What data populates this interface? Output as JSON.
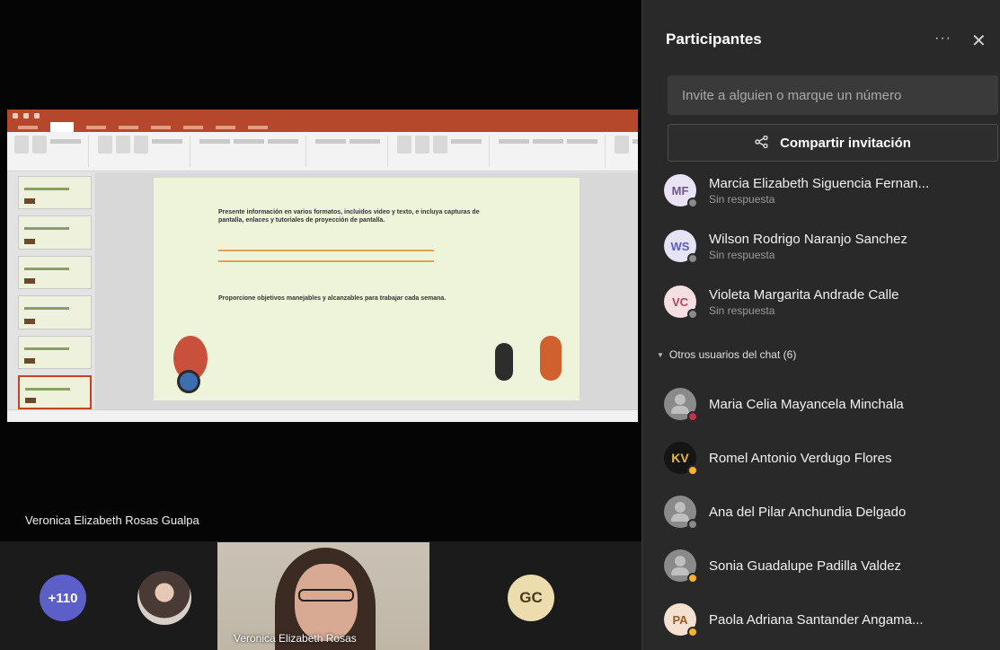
{
  "presenter": {
    "name": "Veronica Elizabeth Rosas Gualpa"
  },
  "slide": {
    "bullet1": "Presente información en varios formatos, incluidos video y texto, e incluya capturas de pantalla, enlaces y tutoriales de proyección de pantalla.",
    "bullet2": "Proporcione objetivos manejables y alcanzables para trabajar cada semana."
  },
  "strip": {
    "more_count": "+110",
    "video_name": "Veronica Elizabeth Rosas",
    "gc_initials": "GC"
  },
  "panel": {
    "title": "Participantes",
    "more_options": "···",
    "close": "✕",
    "invite_placeholder": "Invite a alguien o marque un número",
    "share_label": "Compartir invitación",
    "section_label": "Otros usuarios del chat (6)",
    "participants": [
      {
        "initials": "MF",
        "name": "Marcia Elizabeth Siguencia Fernan...",
        "status": "Sin respuesta"
      },
      {
        "initials": "WS",
        "name": "Wilson Rodrigo Naranjo Sanchez",
        "status": "Sin respuesta"
      },
      {
        "initials": "VC",
        "name": "Violeta Margarita Andrade Calle",
        "status": "Sin respuesta"
      }
    ],
    "chat_users": [
      {
        "initials": "",
        "name": "Maria Celia Mayancela Minchala"
      },
      {
        "initials": "KV",
        "name": "Romel Antonio Verdugo Flores"
      },
      {
        "initials": "",
        "name": "Ana del Pilar Anchundia Delgado"
      },
      {
        "initials": "",
        "name": "Sonia Guadalupe Padilla Valdez"
      },
      {
        "initials": "PA",
        "name": "Paola Adriana Santander Angama..."
      }
    ]
  },
  "colors": {
    "accent": "#5b5fc7",
    "panel_bg": "#292929",
    "ppt_red": "#b7472a",
    "status_away": "#f8b32b",
    "status_busy": "#c4314b"
  }
}
